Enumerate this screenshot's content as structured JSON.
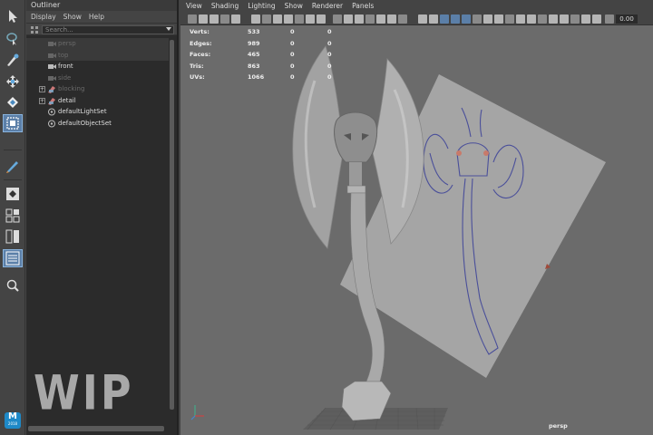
{
  "toolbox": {
    "tools": [
      "select-arrow-icon",
      "lasso-select-icon",
      "paint-select-icon",
      "move-tool-icon",
      "rotate-tool-icon",
      "scale-tool-icon",
      "sculpt-brush-icon",
      "single-perspective-layout-icon",
      "four-view-layout-icon",
      "two-pane-layout-icon",
      "outliner-layout-icon",
      "zoom-magnifier-icon"
    ],
    "logo": "M",
    "logo_sub": "2018"
  },
  "outliner": {
    "title": "Outliner",
    "menu": [
      "Display",
      "Show",
      "Help"
    ],
    "search_placeholder": "Search...",
    "items": [
      {
        "label": "persp",
        "dim": true,
        "icon": "camera-icon",
        "expand": false
      },
      {
        "label": "top",
        "dim": true,
        "icon": "camera-icon",
        "expand": false
      },
      {
        "label": "front",
        "dim": false,
        "icon": "camera-icon",
        "expand": false
      },
      {
        "label": "side",
        "dim": true,
        "icon": "camera-icon",
        "expand": false
      },
      {
        "label": "blocking",
        "dim": true,
        "icon": "mesh-group-icon",
        "expand": true
      },
      {
        "label": "detail",
        "dim": false,
        "icon": "mesh-group-icon",
        "expand": true
      },
      {
        "label": "defaultLightSet",
        "dim": false,
        "icon": "set-icon",
        "expand": false
      },
      {
        "label": "defaultObjectSet",
        "dim": false,
        "icon": "set-icon",
        "expand": false
      }
    ],
    "watermark": "WIP"
  },
  "viewport": {
    "menu": [
      "View",
      "Shading",
      "Lighting",
      "Show",
      "Renderer",
      "Panels"
    ],
    "field_value": "0.00",
    "hud": [
      {
        "label": "Verts:",
        "a": "533",
        "b": "0",
        "c": "0"
      },
      {
        "label": "Edges:",
        "a": "989",
        "b": "0",
        "c": "0"
      },
      {
        "label": "Faces:",
        "a": "465",
        "b": "0",
        "c": "0"
      },
      {
        "label": "Tris:",
        "a": "863",
        "b": "0",
        "c": "0"
      },
      {
        "label": "UVs:",
        "a": "1066",
        "b": "0",
        "c": "0"
      }
    ],
    "camera": "persp",
    "colors": {
      "background": "#6b6b6b",
      "accent": "#5b7fa8"
    }
  }
}
